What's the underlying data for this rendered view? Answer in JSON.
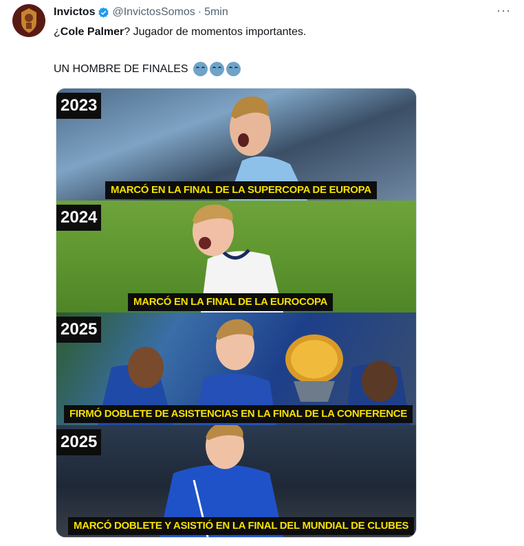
{
  "tweet": {
    "author_name": "Invictos",
    "handle": "@InvictosSomos",
    "separator": "·",
    "time": "5min",
    "more": "···",
    "line1_prefix": "¿",
    "line1_bold": "Cole Palmer",
    "line1_rest": "? Jugador de momentos importantes.",
    "line2": "UN HOMBRE DE FINALES"
  },
  "media": {
    "panels": [
      {
        "year": "2023",
        "caption": "MARCÓ EN LA FINAL DE LA SUPERCOPA DE EUROPA"
      },
      {
        "year": "2024",
        "caption": "MARCÓ EN LA FINAL DE LA EUROCOPA"
      },
      {
        "year": "2025",
        "caption": "FIRMÓ DOBLETE DE ASISTENCIAS EN LA FINAL DE LA CONFERENCE"
      },
      {
        "year": "2025",
        "caption": "MARCÓ DOBLETE Y ASISTIÓ EN LA FINAL DEL MUNDIAL DE CLUBES"
      }
    ]
  },
  "icons": {
    "avatar": "invictos-logo",
    "verified": "verified-badge-icon",
    "more": "more-options-icon",
    "emoji": "crying-face-emoji"
  },
  "colors": {
    "caption_text": "#f6e100",
    "label_bg": "#0d0d0d",
    "verified": "#1d9bf0",
    "muted_text": "#536471"
  }
}
